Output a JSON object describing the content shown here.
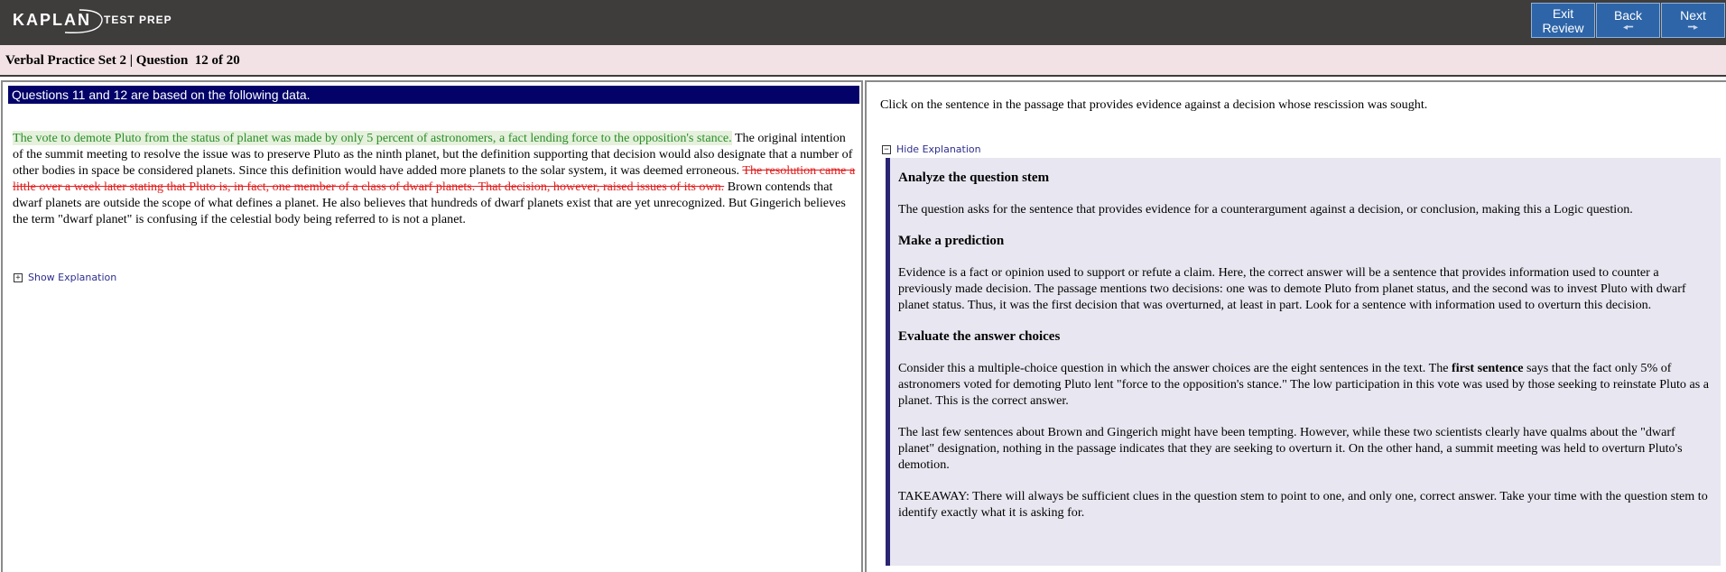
{
  "brand": {
    "logo": "KAPLAN",
    "sub": "TEST PREP"
  },
  "nav": {
    "exit_line1": "Exit",
    "exit_line2": "Review",
    "back": "Back",
    "next": "Next",
    "arrow_glyph": "◂▸"
  },
  "title": "Verbal Practice Set 2 | Question  12 of 20",
  "left": {
    "header": "Questions 11 and 12 are based on the following data.",
    "s1": "The vote to demote Pluto from the status of planet was made by only 5 percent of astronomers, a fact lending force to the opposition's stance.",
    "s2": " The original intention of the summit meeting to resolve the issue was to preserve Pluto as the ninth planet, but the definition supporting that decision would also designate that a number of other bodies in space be considered planets. Since this definition would have added more planets to the solar system, it was deemed erroneous. ",
    "s3": "The resolution came a little over a week later stating that Pluto is, in fact, one member of a class of dwarf planets. That decision, however, raised issues of its own.",
    "s4": " Brown contends that dwarf planets are outside the scope of what defines a planet. He also believes that hundreds of dwarf planets exist that are yet unrecognized. But Gingerich believes the term \"dwarf planet\" is confusing if the celestial body being referred to is not a planet.",
    "show_explanation": "Show Explanation",
    "plus_glyph": "+"
  },
  "right": {
    "prompt": "Click on the sentence in the passage that provides evidence against a decision whose rescission was sought.",
    "hide_explanation": "Hide Explanation",
    "minus_glyph": "−",
    "h1": "Analyze the question stem",
    "p1": "The question asks for the sentence that provides evidence for a counterargument against a decision, or conclusion, making this a Logic question.",
    "h2": "Make a prediction",
    "p2": "Evidence is a fact or opinion used to support or refute a claim. Here, the correct answer will be a sentence that provides information used to counter a previously made decision. The passage mentions two decisions: one was to demote Pluto from planet status, and the second was to invest Pluto with dwarf planet status. Thus, it was the first decision that was overturned, at least in part. Look for a sentence with information used to overturn this decision.",
    "h3": "Evaluate the answer choices",
    "p3a": "Consider this a multiple-choice question in which the answer choices are the eight sentences in the text. The ",
    "p3b": "first sentence",
    "p3c": " says that the fact only 5% of astronomers voted for demoting Pluto lent \"force to the opposition's stance.\" The low participation in this vote was used by those seeking to reinstate Pluto as a planet. This is the correct answer.",
    "p4": "The last few sentences about Brown and Gingerich might have been tempting. However, while these two scientists clearly have qualms about the \"dwarf planet\" designation, nothing in the passage indicates that they are seeking to overturn it. On the other hand, a summit meeting was held to overturn Pluto's demotion.",
    "p5": "TAKEAWAY: There will always be sufficient clues in the question stem to point to one, and only one, correct answer. Take your time with the question stem to identify exactly what it is asking for."
  },
  "colors": {
    "topbar": "#3f3c3c",
    "button": "#2e65a8",
    "titlebar": "#f2e2e5",
    "header_bar": "#020269",
    "highlight_bg": "#e5f1dc",
    "highlight_text": "#2a8d2a",
    "strike_text": "#e02020",
    "explain_bg": "#e8e6f0",
    "explain_border": "#2a2473"
  }
}
